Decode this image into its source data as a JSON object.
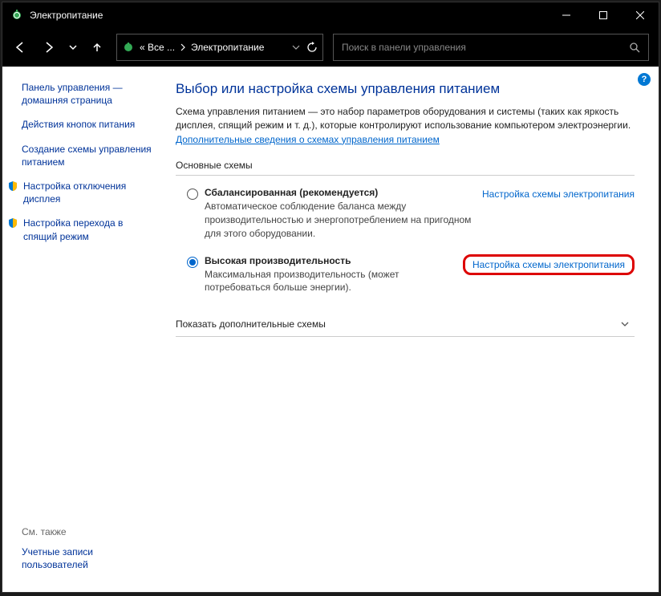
{
  "titlebar": {
    "title": "Электропитание"
  },
  "address": {
    "prefix": "« Все ...",
    "current": "Электропитание"
  },
  "search": {
    "placeholder": "Поиск в панели управления"
  },
  "sidebar": {
    "home": "Панель управления — домашняя страница",
    "items": [
      "Действия кнопок питания",
      "Создание схемы управления питанием",
      "Настройка отключения дисплея",
      "Настройка перехода в спящий режим"
    ],
    "seealso_label": "См. также",
    "seealso_link": "Учетные записи пользователей"
  },
  "main": {
    "title": "Выбор или настройка схемы управления питанием",
    "desc": "Схема управления питанием — это набор параметров оборудования и системы (таких как яркость дисплея, спящий режим и т. д.), которые контролируют использование компьютером электроэнергии. ",
    "desc_link": "Дополнительные сведения о схемах управления питанием",
    "section": "Основные схемы",
    "plans": [
      {
        "name": "Сбалансированная (рекомендуется)",
        "desc": "Автоматическое соблюдение баланса между производительностью и энергопотреблением на пригодном для этого оборудовании.",
        "link": "Настройка схемы электропитания",
        "checked": false
      },
      {
        "name": "Высокая производительность",
        "desc": "Максимальная производительность (может потребоваться больше энергии).",
        "link": "Настройка схемы электропитания",
        "checked": true
      }
    ],
    "expand": "Показать дополнительные схемы"
  }
}
